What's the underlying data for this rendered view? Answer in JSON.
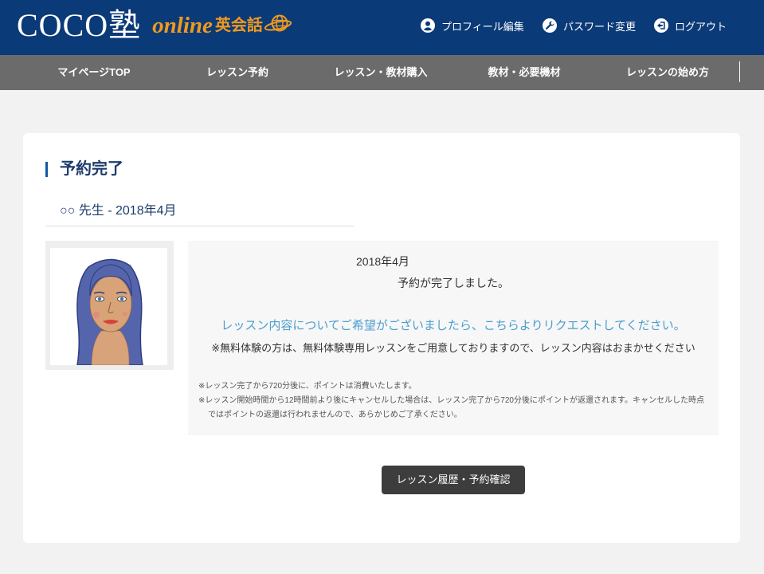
{
  "colors": {
    "page_bg": "#f2f2f2",
    "header_bg": "#0b3a78",
    "nav_bg": "#6b6b6b",
    "accent_orange": "#f09a1e",
    "title_blue": "#1d3c6c",
    "title_accent": "#1456a8",
    "link_blue": "#4b9ecf",
    "button_bg": "#3d3d3d"
  },
  "header": {
    "logo": {
      "main": "COCO塾",
      "online": "online",
      "eikaiwa": "英会話",
      "icon": "globe-icon"
    },
    "links": [
      {
        "label": "プロフィール編集",
        "icon": "user-icon"
      },
      {
        "label": "パスワード変更",
        "icon": "wrench-icon"
      },
      {
        "label": "ログアウト",
        "icon": "logout-icon"
      }
    ]
  },
  "nav": {
    "items": [
      {
        "label": "マイページTOP"
      },
      {
        "label": "レッスン予約"
      },
      {
        "label": "レッスン・教材購入"
      },
      {
        "label": "教材・必要機材"
      },
      {
        "label": "レッスンの始め方"
      }
    ]
  },
  "main": {
    "title": "予約完了",
    "teacher_line": "○○ 先生 - 2018年4月",
    "info": {
      "date": "2018年4月",
      "message": "予約が完了しました。",
      "request_link": "レッスン内容についてご希望がございましたら、こちらよりリクエストしてください。",
      "trial_note": "※無料体験の方は、無料体験専用レッスンをご用意しておりますので、レッスン内容はおまかせください",
      "notes": [
        {
          "lines": [
            "※レッスン完了から720分後に、ポイントは消費いたします。"
          ]
        },
        {
          "lines": [
            "※レッスン開始時間から12時間前より後にキャンセルした場合は、レッスン完了から720分後にポイントが返還されます。キャンセルした時点",
            "ではポイントの返還は行われませんので、あらかじめご了承ください。"
          ]
        }
      ]
    },
    "history_button": "レッスン履歴・予約確認"
  }
}
